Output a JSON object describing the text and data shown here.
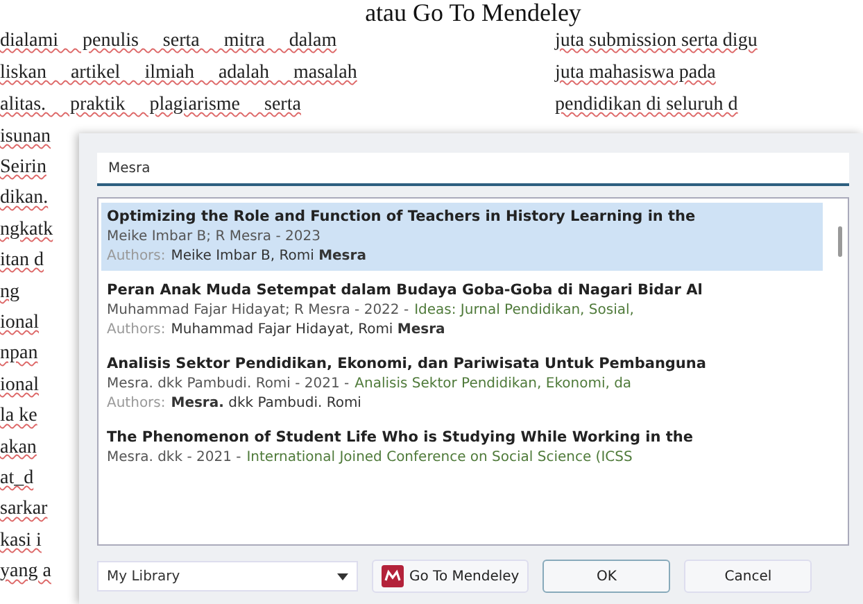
{
  "document": {
    "heading": "atau Go To Mendeley",
    "left_column": [
      "dialami penulis serta mitra dalam",
      "liskan artikel ilmiah adalah masalah",
      "alitas. praktik plagiarisme serta",
      "isunan"
    ],
    "left_fragments": [
      "Seirin",
      "dikan.",
      "ngkatk",
      "itan d",
      "ng",
      "ional",
      "npan",
      "ional",
      "la ke",
      "akan",
      "at_d",
      "sarkar",
      "kasi i",
      "yang a"
    ],
    "right_column": [
      "juta submission serta digu",
      "juta mahasiswa pada",
      "pendidikan di seluruh d"
    ]
  },
  "dialog": {
    "search": {
      "value": "Mesra"
    },
    "results": [
      {
        "title": "Optimizing the Role and Function of Teachers in History Learning in the",
        "meta": "Meike Imbar B; R Mesra - 2023",
        "authors_label": "Authors:",
        "authors": "Meike Imbar B, Romi **Mesra**",
        "selected": true
      },
      {
        "title": "Peran Anak Muda Setempat dalam Budaya Goba-Goba di Nagari Bidar Al",
        "meta": "Muhammad Fajar Hidayat; R Mesra - 2022 -",
        "source": "Ideas: Jurnal Pendidikan, Sosial,",
        "authors_label": "Authors:",
        "authors": "Muhammad Fajar Hidayat, Romi **Mesra**",
        "selected": false
      },
      {
        "title": "Analisis Sektor Pendidikan, Ekonomi, dan Pariwisata Untuk Pembanguna",
        "meta": "Mesra. dkk Pambudi. Romi - 2021 -",
        "source": "Analisis Sektor Pendidikan, Ekonomi, da",
        "authors_label": "Authors:",
        "authors": "**Mesra.** dkk Pambudi. Romi",
        "selected": false
      },
      {
        "title": "The Phenomenon of Student Life Who is Studying While Working in the",
        "meta": "Mesra. dkk - 2021 -",
        "source": "International Joined Conference on Social Science (ICSS",
        "selected": false
      }
    ],
    "library": "My Library",
    "mendeley_button": "Go To Mendeley",
    "ok": "OK",
    "cancel": "Cancel"
  }
}
